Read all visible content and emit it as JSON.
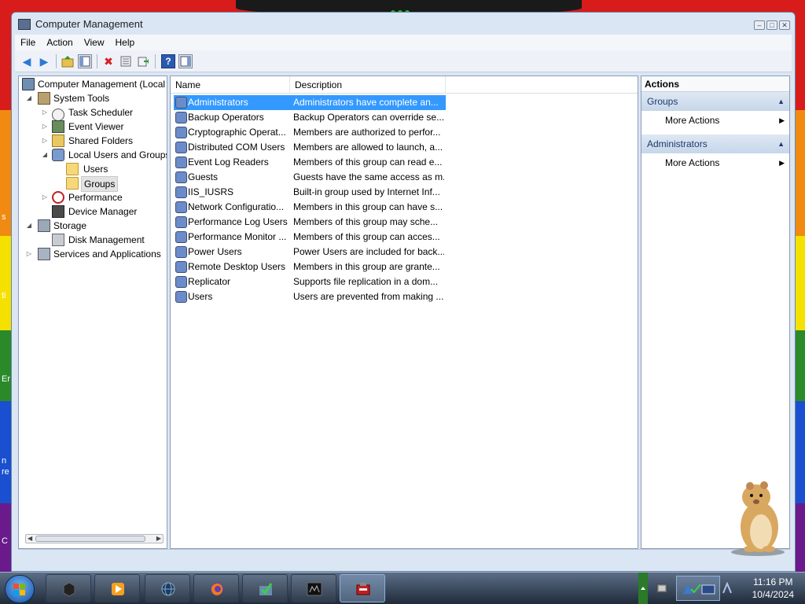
{
  "window": {
    "title": "Computer Management",
    "controls": {
      "minimize": "–",
      "maximize": "□",
      "close": "✕"
    }
  },
  "menu": {
    "items": [
      "File",
      "Action",
      "View",
      "Help"
    ]
  },
  "toolbar": {
    "buttons": [
      "back-icon",
      "forward-icon",
      "up-folder-icon",
      "show-hide-tree-icon",
      "delete-icon",
      "properties-icon",
      "export-list-icon",
      "help-icon",
      "show-hide-action-pane-icon"
    ]
  },
  "tree": {
    "items": [
      {
        "label": "Computer Management (Local",
        "icon": "computer-icon",
        "expander": ""
      },
      {
        "label": "System Tools",
        "icon": "tools-icon",
        "expander": "◢"
      },
      {
        "label": "Task Scheduler",
        "icon": "clock-icon",
        "expander": "▷"
      },
      {
        "label": "Event Viewer",
        "icon": "event-viewer-icon",
        "expander": "▷"
      },
      {
        "label": "Shared Folders",
        "icon": "shared-folder-icon",
        "expander": "▷"
      },
      {
        "label": "Local Users and Groups",
        "icon": "users-icon",
        "expander": "◢"
      },
      {
        "label": "Users",
        "icon": "folder-icon",
        "expander": ""
      },
      {
        "label": "Groups",
        "icon": "folder-icon",
        "expander": ""
      },
      {
        "label": "Performance",
        "icon": "performance-icon",
        "expander": "▷"
      },
      {
        "label": "Device Manager",
        "icon": "device-manager-icon",
        "expander": ""
      },
      {
        "label": "Storage",
        "icon": "storage-icon",
        "expander": "◢"
      },
      {
        "label": "Disk Management",
        "icon": "disk-icon",
        "expander": ""
      },
      {
        "label": "Services and Applications",
        "icon": "services-icon",
        "expander": "▷"
      }
    ]
  },
  "list": {
    "columns": [
      "Name",
      "Description"
    ],
    "rows": [
      {
        "name": "Administrators",
        "description": "Administrators have complete an..."
      },
      {
        "name": "Backup Operators",
        "description": "Backup Operators can override se..."
      },
      {
        "name": "Cryptographic Operat...",
        "description": "Members are authorized to perfor..."
      },
      {
        "name": "Distributed COM Users",
        "description": "Members are allowed to launch, a..."
      },
      {
        "name": "Event Log Readers",
        "description": "Members of this group can read e..."
      },
      {
        "name": "Guests",
        "description": "Guests have the same access as m..."
      },
      {
        "name": "IIS_IUSRS",
        "description": "Built-in group used by Internet Inf..."
      },
      {
        "name": "Network Configuratio...",
        "description": "Members in this group can have s..."
      },
      {
        "name": "Performance Log Users",
        "description": "Members of this group may sche..."
      },
      {
        "name": "Performance Monitor ...",
        "description": "Members of this group can acces..."
      },
      {
        "name": "Power Users",
        "description": "Power Users are included for back..."
      },
      {
        "name": "Remote Desktop Users",
        "description": "Members in this group are grante..."
      },
      {
        "name": "Replicator",
        "description": "Supports file replication in a dom..."
      },
      {
        "name": "Users",
        "description": "Users are prevented from making ..."
      }
    ],
    "selected_index": 0
  },
  "actions": {
    "title": "Actions",
    "sections": [
      {
        "header": "Groups",
        "items": [
          "More Actions"
        ]
      },
      {
        "header": "Administrators",
        "items": [
          "More Actions"
        ]
      }
    ]
  },
  "taskbar": {
    "clock_time": "11:16 PM",
    "clock_date": "10/4/2024",
    "buttons": [
      "vm-box-icon",
      "media-player-icon",
      "globe-icon",
      "firefox-icon",
      "checkmark-app-icon",
      "terminal-icon",
      "computer-management-icon"
    ]
  },
  "colors": {
    "selection": "#3399ff",
    "window_frame": "#dbe6f4",
    "action_header": "#c7d6ea"
  }
}
